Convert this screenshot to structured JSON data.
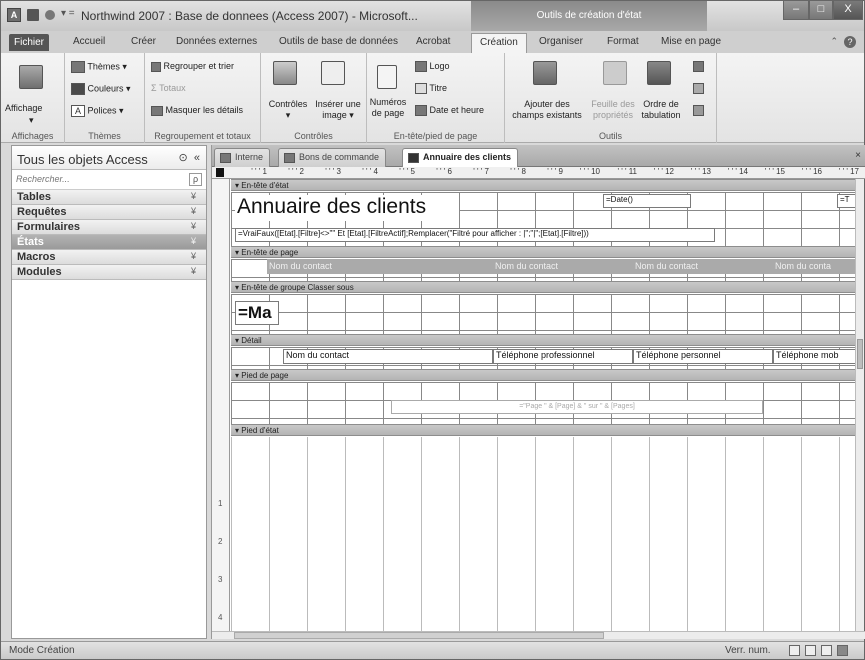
{
  "window": {
    "title": "Northwind 2007 : Base de donnees (Access 2007) - Microsoft...",
    "context_tab": "Outils de création d'état",
    "controls": {
      "minimize": "–",
      "maximize": "□",
      "close": "X"
    }
  },
  "ribbon_tabs": [
    {
      "label": "Fichier"
    },
    {
      "label": "Accueil"
    },
    {
      "label": "Créer"
    },
    {
      "label": "Données externes"
    },
    {
      "label": "Outils de base de données"
    },
    {
      "label": "Acrobat"
    },
    {
      "label": "Création",
      "active": true
    },
    {
      "label": "Organiser"
    },
    {
      "label": "Format"
    },
    {
      "label": "Mise en page"
    }
  ],
  "ribbon": {
    "groups": {
      "affichages": {
        "label": "Affichages",
        "buttons": {
          "affichage": "Affichage"
        }
      },
      "themes": {
        "label": "Thèmes",
        "buttons": {
          "themes": "Thèmes",
          "couleurs": "Couleurs",
          "polices": "Polices"
        }
      },
      "regroupement": {
        "label": "Regroupement et totaux",
        "buttons": {
          "regrouper": "Regrouper et trier",
          "totaux": "Totaux",
          "masquer": "Masquer les détails"
        }
      },
      "controles": {
        "label": "Contrôles",
        "buttons": {
          "controles": "Contrôles",
          "inserer_image": "Insérer une image"
        }
      },
      "entete": {
        "label": "En-tête/pied de page",
        "buttons": {
          "numeros": "Numéros de page",
          "logo": "Logo",
          "titre": "Titre",
          "date": "Date et heure"
        }
      },
      "outils": {
        "label": "Outils",
        "buttons": {
          "ajouter": "Ajouter des champs existants",
          "feuille": "Feuille des propriétés",
          "ordre": "Ordre de tabulation"
        }
      }
    }
  },
  "nav": {
    "title": "Tous les objets Access",
    "search_placeholder": "Rechercher...",
    "items": [
      {
        "label": "Tables"
      },
      {
        "label": "Requêtes"
      },
      {
        "label": "Formulaires"
      },
      {
        "label": "États",
        "selected": true
      },
      {
        "label": "Macros"
      },
      {
        "label": "Modules"
      }
    ]
  },
  "doc_tabs": [
    {
      "label": "Interne"
    },
    {
      "label": "Bons de commande"
    },
    {
      "label": "Annuaire des clients",
      "active": true
    }
  ],
  "ruler": {
    "marks": [
      "1",
      "2",
      "3",
      "4",
      "5",
      "6",
      "7",
      "8",
      "9",
      "10",
      "11",
      "12",
      "13",
      "14",
      "15",
      "16",
      "17"
    ]
  },
  "vruler": {
    "marks": [
      "1",
      "2",
      "3",
      "4"
    ]
  },
  "report": {
    "sections": {
      "report_header": "En-tête d'état",
      "page_header": "En-tête de page",
      "group_header": "En-tête de groupe Classer sous",
      "detail": "Détail",
      "page_footer": "Pied de page",
      "report_footer": "Pied d'état"
    },
    "controls": {
      "title": "Annuaire des clients",
      "date": "=Date()",
      "date_right": "=T",
      "filter_expr": "=VraiFaux([Etat].[Filtre]<>\"\" Et [Etat].[FiltreActif];Remplacer(\"Filtré pour afficher : |\";\"|\";[Etat].[Filtre]))",
      "hdr_nom": "Nom du contact",
      "hdr_nom_dim1": "Nom du contact",
      "hdr_nom_dim2": "Nom du contact",
      "hdr_nom_dim3": "Nom du conta",
      "group_field": "=Ma",
      "detail_nom": "Nom du contact",
      "detail_tel_pro": "Téléphone professionnel",
      "detail_tel_perso": "Téléphone personnel",
      "detail_tel_mob": "Téléphone mob",
      "page_expr": "=\"Page \" & [Page] & \" sur \" & [Pages]"
    }
  },
  "status": {
    "mode": "Mode Création",
    "verr": "Verr. num."
  }
}
